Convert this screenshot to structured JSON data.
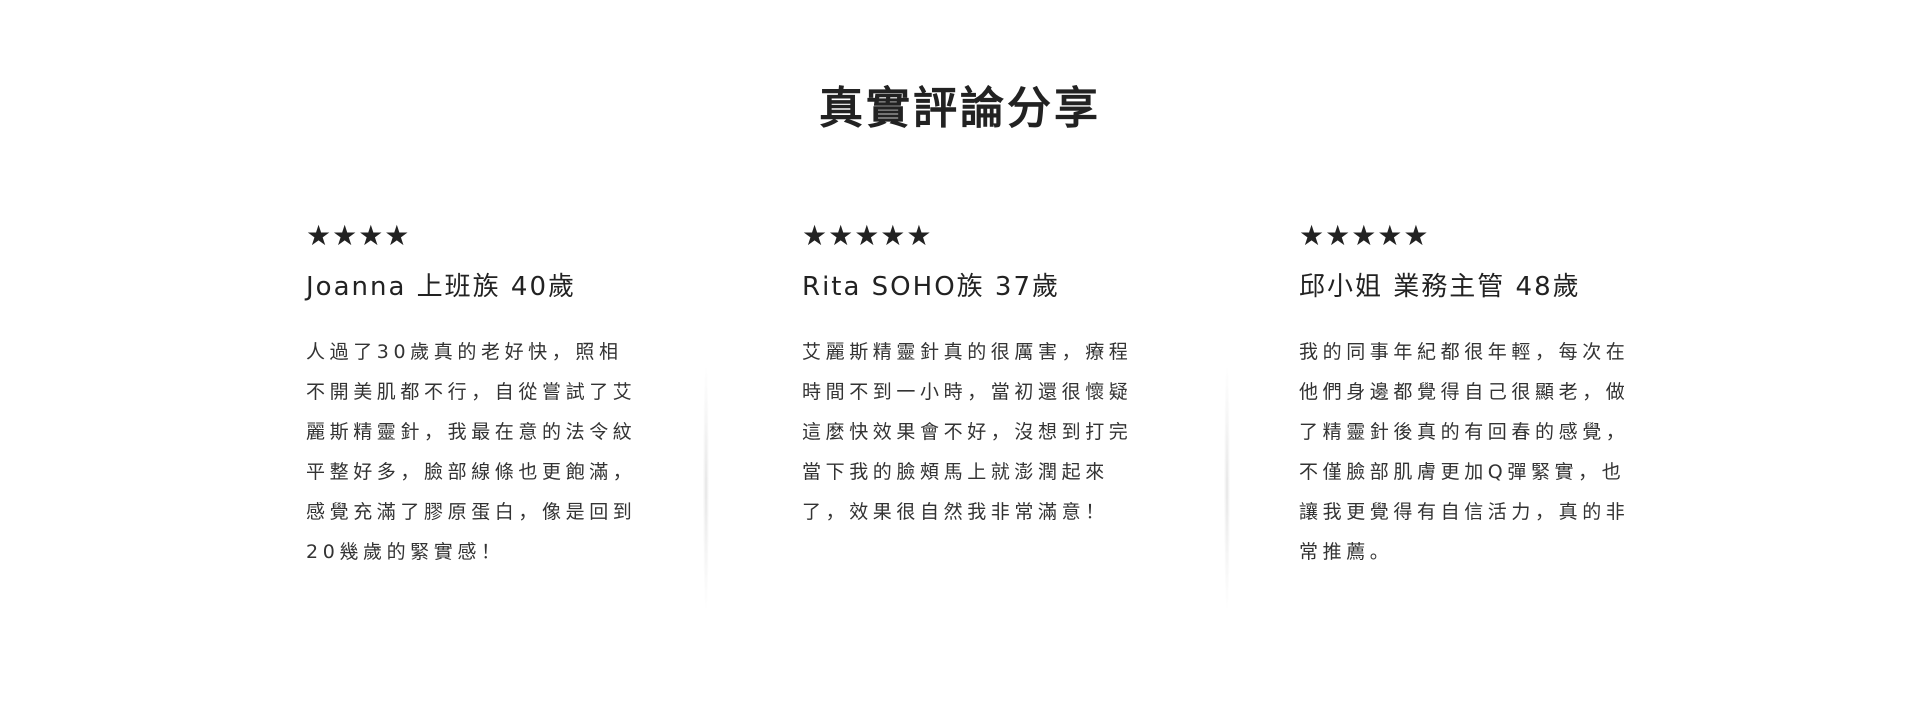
{
  "section": {
    "title": "真實評論分享"
  },
  "reviews": [
    {
      "stars": "★★★★",
      "rating": 4,
      "reviewer": "Joanna 上班族 40歲",
      "text": "人過了30歲真的老好快，照相不開美肌都不行，自從嘗試了艾麗斯精靈針，我最在意的法令紋平整好多，臉部線條也更飽滿，感覺充滿了膠原蛋白，像是回到20幾歲的緊實感！"
    },
    {
      "stars": "★★★★★",
      "rating": 5,
      "reviewer": "Rita SOHO族 37歲",
      "text": "艾麗斯精靈針真的很厲害，療程時間不到一小時，當初還很懷疑這麼快效果會不好，沒想到打完當下我的臉頰馬上就澎潤起來了，效果很自然我非常滿意！"
    },
    {
      "stars": "★★★★★",
      "rating": 5,
      "reviewer": "邱小姐 業務主管 48歲",
      "text": "我的同事年紀都很年輕，每次在他們身邊都覺得自己很顯老，做了精靈針後真的有回春的感覺，不僅臉部肌膚更加Q彈緊實，也讓我更覺得有自信活力，真的非常推薦。"
    }
  ]
}
